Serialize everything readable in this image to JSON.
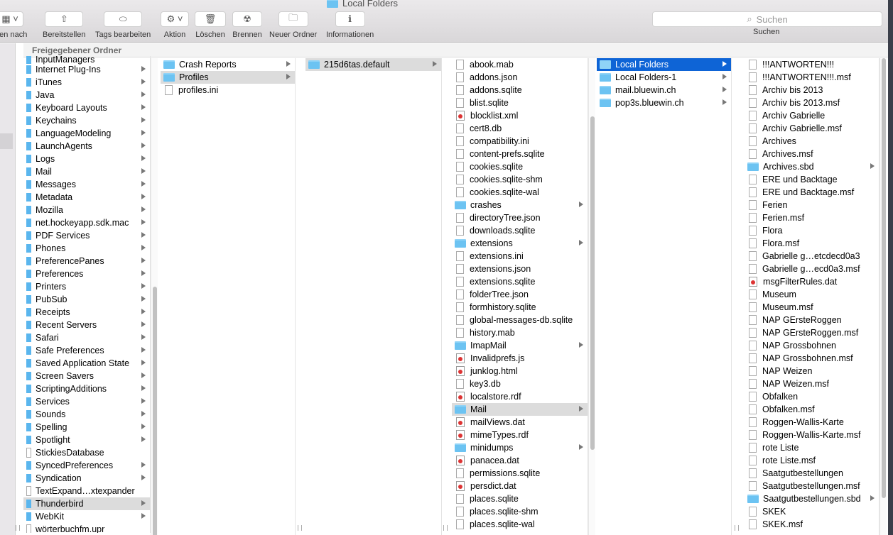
{
  "window": {
    "title": "Local Folders"
  },
  "toolbar": {
    "view_label": "hten nach",
    "share_label": "Bereitstellen",
    "tags_label": "Tags bearbeiten",
    "action_label": "Aktion",
    "delete_label": "Löschen",
    "burn_label": "Brennen",
    "new_folder_label": "Neuer Ordner",
    "info_label": "Informationen",
    "search_placeholder": "Suchen",
    "search_label": "Suchen"
  },
  "pathbar": {
    "label": "Freigegebener Ordner"
  },
  "columns": [
    {
      "items": [
        {
          "name": "InputManagers",
          "kind": "narrow",
          "arrow": false
        },
        {
          "name": "Internet Plug-Ins",
          "kind": "narrow",
          "arrow": true
        },
        {
          "name": "iTunes",
          "kind": "narrow",
          "arrow": true
        },
        {
          "name": "Java",
          "kind": "narrow",
          "arrow": true
        },
        {
          "name": "Keyboard Layouts",
          "kind": "narrow",
          "arrow": true
        },
        {
          "name": "Keychains",
          "kind": "narrow",
          "arrow": true
        },
        {
          "name": "LanguageModeling",
          "kind": "narrow",
          "arrow": true
        },
        {
          "name": "LaunchAgents",
          "kind": "narrow",
          "arrow": true
        },
        {
          "name": "Logs",
          "kind": "narrow",
          "arrow": true
        },
        {
          "name": "Mail",
          "kind": "narrow",
          "arrow": true
        },
        {
          "name": "Messages",
          "kind": "narrow",
          "arrow": true
        },
        {
          "name": "Metadata",
          "kind": "narrow",
          "arrow": true
        },
        {
          "name": "Mozilla",
          "kind": "narrow",
          "arrow": true
        },
        {
          "name": "net.hockeyapp.sdk.mac",
          "kind": "narrow",
          "arrow": true
        },
        {
          "name": "PDF Services",
          "kind": "narrow",
          "arrow": true
        },
        {
          "name": "Phones",
          "kind": "narrow",
          "arrow": true
        },
        {
          "name": "PreferencePanes",
          "kind": "narrow",
          "arrow": true
        },
        {
          "name": "Preferences",
          "kind": "narrow",
          "arrow": true
        },
        {
          "name": "Printers",
          "kind": "narrow",
          "arrow": true
        },
        {
          "name": "PubSub",
          "kind": "narrow",
          "arrow": true
        },
        {
          "name": "Receipts",
          "kind": "narrow",
          "arrow": true
        },
        {
          "name": "Recent Servers",
          "kind": "narrow",
          "arrow": true
        },
        {
          "name": "Safari",
          "kind": "narrow",
          "arrow": true
        },
        {
          "name": "Safe Preferences",
          "kind": "narrow",
          "arrow": true
        },
        {
          "name": "Saved Application State",
          "kind": "narrow",
          "arrow": true
        },
        {
          "name": "Screen Savers",
          "kind": "narrow",
          "arrow": true
        },
        {
          "name": "ScriptingAdditions",
          "kind": "narrow",
          "arrow": true
        },
        {
          "name": "Services",
          "kind": "narrow",
          "arrow": true
        },
        {
          "name": "Sounds",
          "kind": "narrow",
          "arrow": true
        },
        {
          "name": "Spelling",
          "kind": "narrow",
          "arrow": true
        },
        {
          "name": "Spotlight",
          "kind": "narrow",
          "arrow": true
        },
        {
          "name": "StickiesDatabase",
          "kind": "narrowdoc",
          "arrow": false
        },
        {
          "name": "SyncedPreferences",
          "kind": "narrow",
          "arrow": true
        },
        {
          "name": "Syndication",
          "kind": "narrow",
          "arrow": true
        },
        {
          "name": "TextExpand…xtexpander",
          "kind": "narrowdoc",
          "arrow": false
        },
        {
          "name": "Thunderbird",
          "kind": "narrow",
          "arrow": true,
          "sel": "grey"
        },
        {
          "name": "WebKit",
          "kind": "narrow",
          "arrow": true
        },
        {
          "name": "wörterbuchfm.upr",
          "kind": "narrowdoc",
          "arrow": false
        }
      ]
    },
    {
      "items": [
        {
          "name": "Crash Reports",
          "kind": "folder",
          "arrow": true
        },
        {
          "name": "Profiles",
          "kind": "folder",
          "arrow": true,
          "sel": "grey"
        },
        {
          "name": "profiles.ini",
          "kind": "file",
          "arrow": false
        }
      ]
    },
    {
      "items": [
        {
          "name": "215d6tas.default",
          "kind": "folder",
          "arrow": true,
          "sel": "grey"
        }
      ]
    },
    {
      "items": [
        {
          "name": "abook.mab",
          "kind": "file"
        },
        {
          "name": "addons.json",
          "kind": "file"
        },
        {
          "name": "addons.sqlite",
          "kind": "file"
        },
        {
          "name": "blist.sqlite",
          "kind": "file"
        },
        {
          "name": "blocklist.xml",
          "kind": "special"
        },
        {
          "name": "cert8.db",
          "kind": "file"
        },
        {
          "name": "compatibility.ini",
          "kind": "file"
        },
        {
          "name": "content-prefs.sqlite",
          "kind": "file"
        },
        {
          "name": "cookies.sqlite",
          "kind": "file"
        },
        {
          "name": "cookies.sqlite-shm",
          "kind": "file"
        },
        {
          "name": "cookies.sqlite-wal",
          "kind": "file"
        },
        {
          "name": "crashes",
          "kind": "folder",
          "arrow": true
        },
        {
          "name": "directoryTree.json",
          "kind": "file"
        },
        {
          "name": "downloads.sqlite",
          "kind": "file"
        },
        {
          "name": "extensions",
          "kind": "folder",
          "arrow": true
        },
        {
          "name": "extensions.ini",
          "kind": "file"
        },
        {
          "name": "extensions.json",
          "kind": "file"
        },
        {
          "name": "extensions.sqlite",
          "kind": "file"
        },
        {
          "name": "folderTree.json",
          "kind": "file"
        },
        {
          "name": "formhistory.sqlite",
          "kind": "file"
        },
        {
          "name": "global-messages-db.sqlite",
          "kind": "file"
        },
        {
          "name": "history.mab",
          "kind": "file"
        },
        {
          "name": "ImapMail",
          "kind": "folder",
          "arrow": true
        },
        {
          "name": "Invalidprefs.js",
          "kind": "special"
        },
        {
          "name": "junklog.html",
          "kind": "special"
        },
        {
          "name": "key3.db",
          "kind": "file"
        },
        {
          "name": "localstore.rdf",
          "kind": "special"
        },
        {
          "name": "Mail",
          "kind": "folder",
          "arrow": true,
          "sel": "grey"
        },
        {
          "name": "mailViews.dat",
          "kind": "special"
        },
        {
          "name": "mimeTypes.rdf",
          "kind": "special"
        },
        {
          "name": "minidumps",
          "kind": "folder",
          "arrow": true
        },
        {
          "name": "panacea.dat",
          "kind": "special"
        },
        {
          "name": "permissions.sqlite",
          "kind": "file"
        },
        {
          "name": "persdict.dat",
          "kind": "special"
        },
        {
          "name": "places.sqlite",
          "kind": "file"
        },
        {
          "name": "places.sqlite-shm",
          "kind": "file"
        },
        {
          "name": "places.sqlite-wal",
          "kind": "file"
        }
      ]
    },
    {
      "items": [
        {
          "name": "Local Folders",
          "kind": "folder",
          "arrow": true,
          "sel": "blue"
        },
        {
          "name": "Local Folders-1",
          "kind": "folder",
          "arrow": true
        },
        {
          "name": "mail.bluewin.ch",
          "kind": "folder",
          "arrow": true
        },
        {
          "name": "pop3s.bluewin.ch",
          "kind": "folder",
          "arrow": true
        }
      ]
    },
    {
      "items": [
        {
          "name": "!!!ANTWORTEN!!!",
          "kind": "file"
        },
        {
          "name": "!!!ANTWORTEN!!!.msf",
          "kind": "file"
        },
        {
          "name": "Archiv bis 2013",
          "kind": "file"
        },
        {
          "name": "Archiv bis 2013.msf",
          "kind": "file"
        },
        {
          "name": "Archiv Gabrielle",
          "kind": "file"
        },
        {
          "name": "Archiv Gabrielle.msf",
          "kind": "file"
        },
        {
          "name": "Archives",
          "kind": "file"
        },
        {
          "name": "Archives.msf",
          "kind": "file"
        },
        {
          "name": "Archives.sbd",
          "kind": "folder",
          "arrow": true
        },
        {
          "name": "ERE und Backtage",
          "kind": "file"
        },
        {
          "name": "ERE und Backtage.msf",
          "kind": "file"
        },
        {
          "name": "Ferien",
          "kind": "file"
        },
        {
          "name": "Ferien.msf",
          "kind": "file"
        },
        {
          "name": "Flora",
          "kind": "file"
        },
        {
          "name": "Flora.msf",
          "kind": "file"
        },
        {
          "name": "Gabrielle g…etcdecd0a3",
          "kind": "file"
        },
        {
          "name": "Gabrielle g…ecd0a3.msf",
          "kind": "file"
        },
        {
          "name": "msgFilterRules.dat",
          "kind": "special"
        },
        {
          "name": "Museum",
          "kind": "file"
        },
        {
          "name": "Museum.msf",
          "kind": "file"
        },
        {
          "name": "NAP GErsteRoggen",
          "kind": "file"
        },
        {
          "name": "NAP GErsteRoggen.msf",
          "kind": "file"
        },
        {
          "name": "NAP Grossbohnen",
          "kind": "file"
        },
        {
          "name": "NAP Grossbohnen.msf",
          "kind": "file"
        },
        {
          "name": "NAP Weizen",
          "kind": "file"
        },
        {
          "name": "NAP Weizen.msf",
          "kind": "file"
        },
        {
          "name": "Obfalken",
          "kind": "file"
        },
        {
          "name": "Obfalken.msf",
          "kind": "file"
        },
        {
          "name": "Roggen-Wallis-Karte",
          "kind": "file"
        },
        {
          "name": "Roggen-Wallis-Karte.msf",
          "kind": "file"
        },
        {
          "name": "rote Liste",
          "kind": "file"
        },
        {
          "name": "rote Liste.msf",
          "kind": "file"
        },
        {
          "name": "Saatgutbestellungen",
          "kind": "file"
        },
        {
          "name": "Saatgutbestellungen.msf",
          "kind": "file"
        },
        {
          "name": "Saatgutbestellungen.sbd",
          "kind": "folder",
          "arrow": true
        },
        {
          "name": "SKEK",
          "kind": "file"
        },
        {
          "name": "SKEK.msf",
          "kind": "file"
        }
      ]
    }
  ]
}
